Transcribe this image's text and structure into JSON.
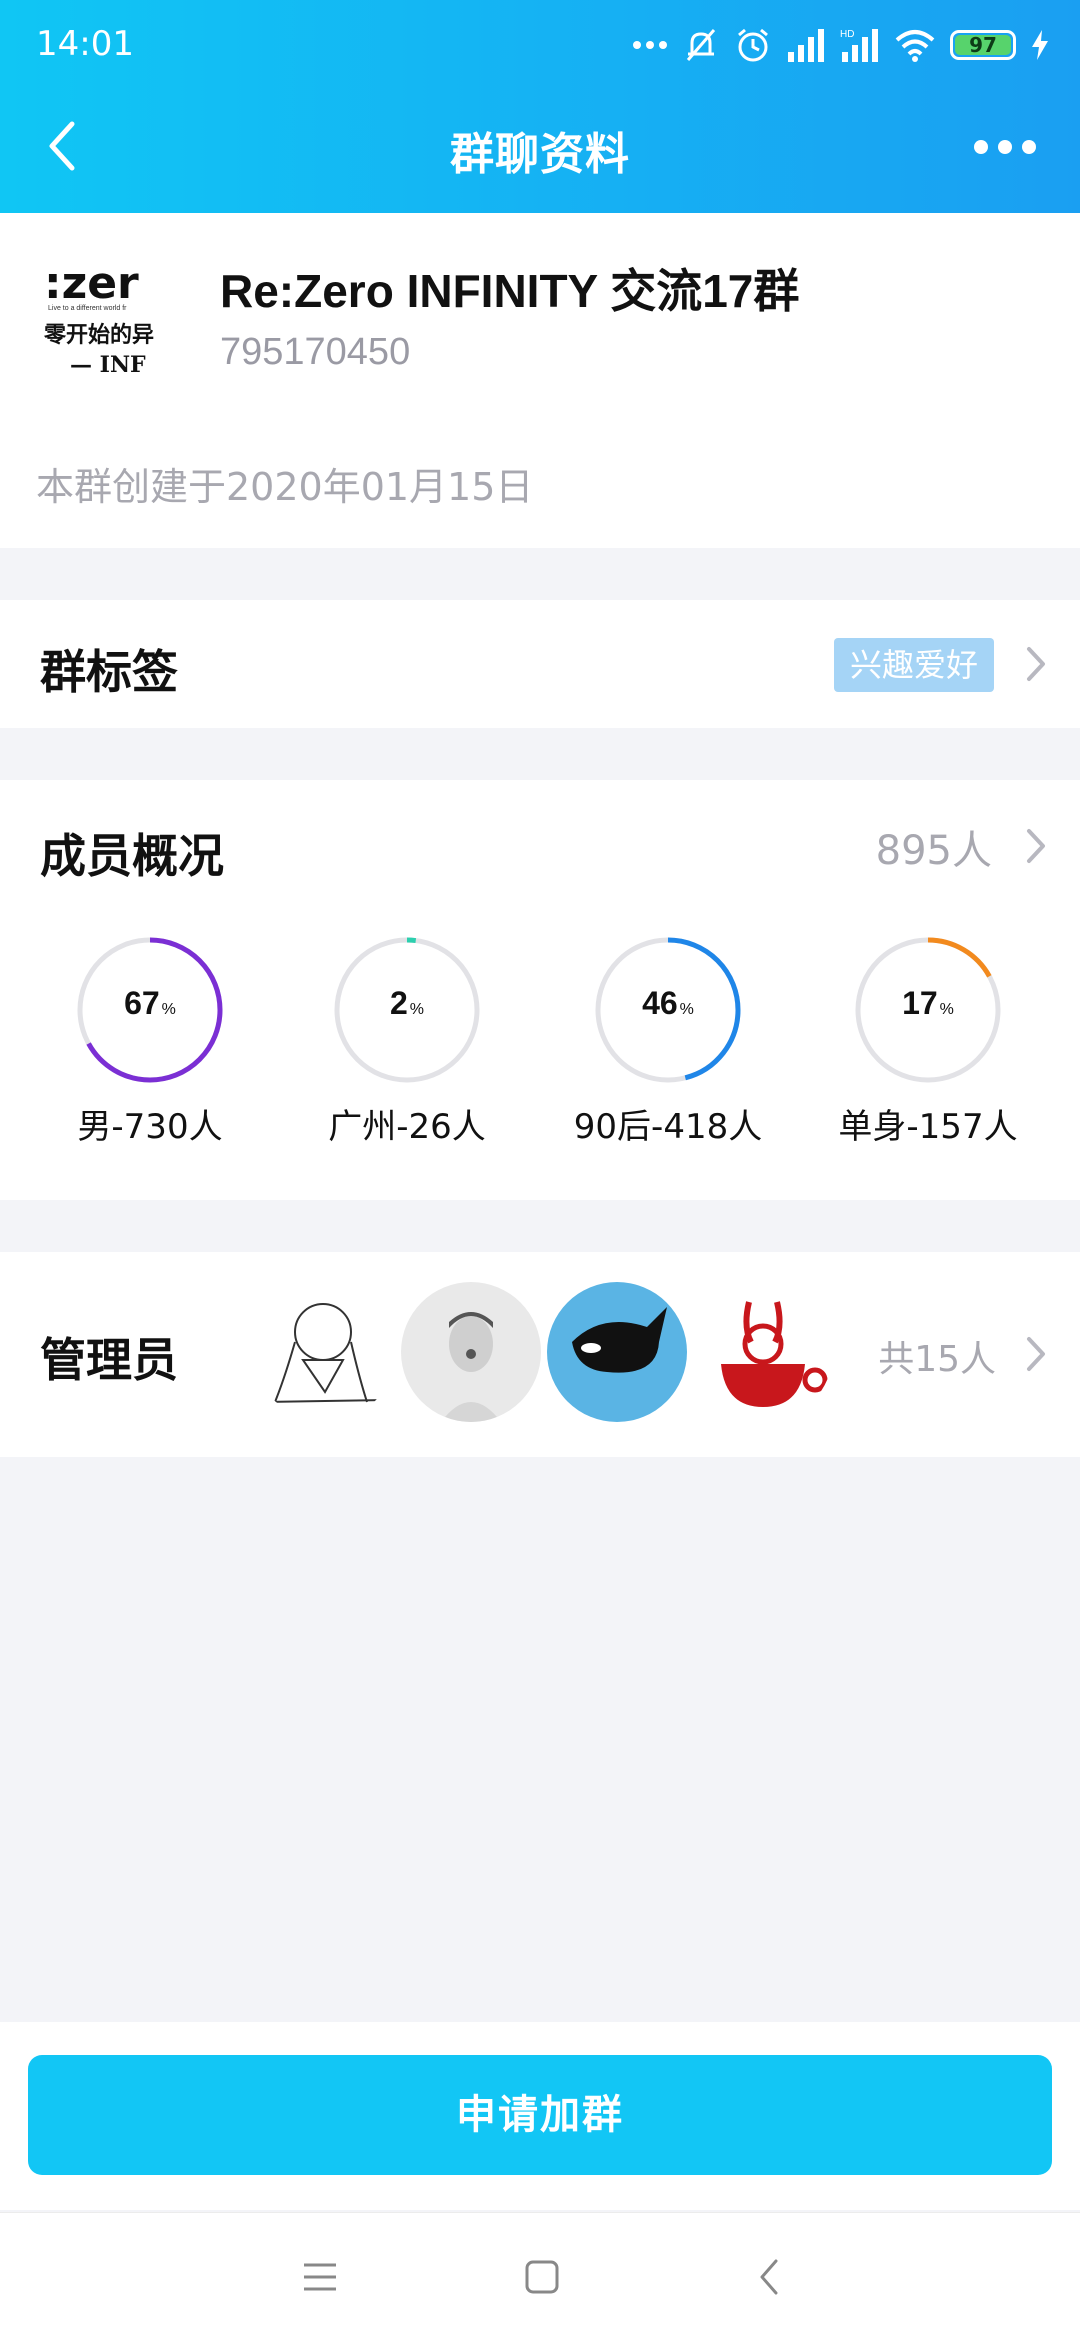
{
  "status_bar": {
    "time": "14:01",
    "battery": "97",
    "icons": [
      "more-dots-icon",
      "mute-bell-icon",
      "alarm-icon",
      "signal-icon",
      "hd-signal-icon",
      "wifi-icon",
      "battery-icon",
      "charging-icon"
    ]
  },
  "header": {
    "title": "群聊资料",
    "back_icon": "chevron-left-icon",
    "more_icon": "more-horizontal-icon"
  },
  "group": {
    "name": "Re:Zero INFINITY 交流17群",
    "id": "795170450",
    "created": "本群创建于2020年01月15日",
    "avatar_text_line1": ":zer",
    "avatar_text_line2": "零开始的异",
    "avatar_text_line3": "— INF"
  },
  "tags": {
    "label": "群标签",
    "value": "兴趣爱好"
  },
  "members": {
    "label": "成员概况",
    "count": "895人",
    "stats": [
      {
        "percent": "67",
        "unit": "%",
        "label": "男-730人",
        "value": 0.67,
        "color": "#7b2fd4"
      },
      {
        "percent": "2",
        "unit": "%",
        "label": "广州-26人",
        "value": 0.02,
        "color": "#2ccfae"
      },
      {
        "percent": "46",
        "unit": "%",
        "label": "90后-418人",
        "value": 0.46,
        "color": "#1f86e8"
      },
      {
        "percent": "17",
        "unit": "%",
        "label": "单身-157人",
        "value": 0.17,
        "color": "#f28a1e"
      }
    ]
  },
  "admins": {
    "label": "管理员",
    "total": "共15人"
  },
  "join_button": "申请加群"
}
